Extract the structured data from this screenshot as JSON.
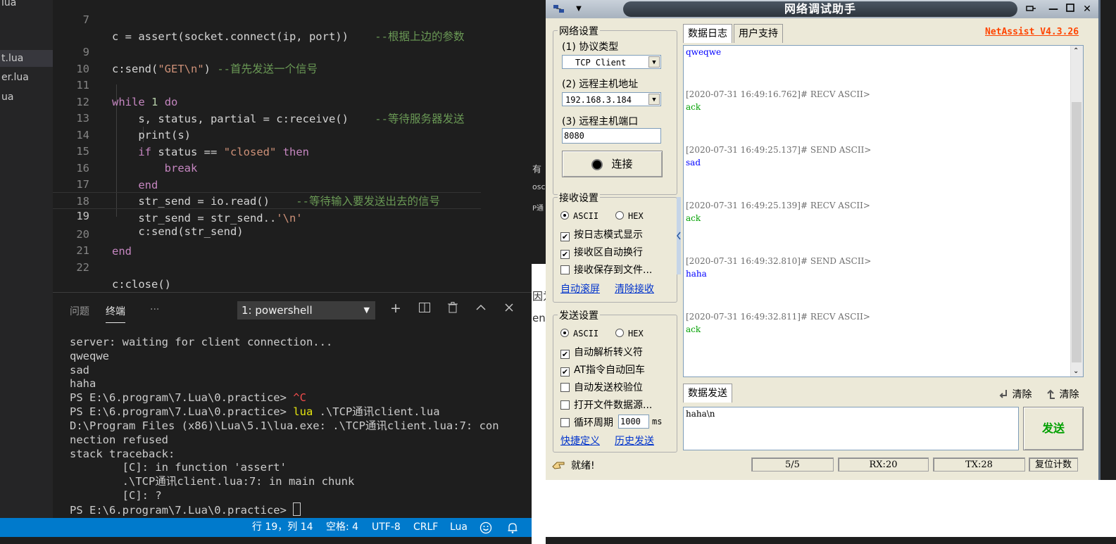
{
  "vscode": {
    "explorer": [
      "lua",
      "t.lua",
      "er.lua",
      "ua"
    ],
    "line_numbers": [
      "7",
      "9",
      "10",
      "11",
      "12",
      "13",
      "14",
      "15",
      "16",
      "17",
      "18",
      "19",
      "20",
      "21",
      "22"
    ],
    "code": {
      "l7": "c = assert(socket.connect(ip, port))",
      "l7_comment": "--根据上边的参数",
      "l9_fn": "c:send(",
      "l9_str": "\"GET\\n\"",
      "l9_close": ")",
      "l9_comment": "--首先发送一个信号",
      "l11_kw": "while",
      "l11_num": "1",
      "l11_do": "do",
      "l12": "s, status, partial = c:receive()",
      "l12_comment": "--等待服务器发送",
      "l13": "print(s)",
      "l14_if": "if",
      "l14_mid": "status ==",
      "l14_str": "\"closed\"",
      "l14_then": "then",
      "l15": "break",
      "l16": "end",
      "l17": "str_send = io.read()",
      "l17_comment": "--等待输入要发送出去的信号",
      "l18": "str_send = str_send..",
      "l18_str": "'\\n'",
      "l19": "c:send(str_send)",
      "l20": "end",
      "l22": "c:close()"
    },
    "panel": {
      "tab_problems": "问题",
      "tab_terminal": "终端",
      "more": "···",
      "terminal_select": "1: powershell"
    },
    "terminal": {
      "l1": "server: waiting for client connection...",
      "l2": "qweqwe",
      "l3": "sad",
      "l4": "haha",
      "l5_prompt": "PS E:\\6.program\\7.Lua\\0.practice> ",
      "l5_ctrl": "^C",
      "l6_prompt": "PS E:\\6.program\\7.Lua\\0.practice> ",
      "l6_cmd": "lua",
      "l6_arg": " .\\TCP通讯client.lua",
      "l7": "D:\\Program Files (x86)\\Lua\\5.1\\lua.exe: .\\TCP通讯client.lua:7: con",
      "l8": "nection refused",
      "l9": "stack traceback:",
      "l10": "        [C]: in function 'assert'",
      "l11": "        .\\TCP通讯client.lua:7: in main chunk",
      "l12": "        [C]: ?",
      "l13": "PS E:\\6.program\\7.Lua\\0.practice> "
    },
    "statusbar": {
      "position": "行 19，列 14",
      "spaces": "空格: 4",
      "encoding": "UTF-8",
      "eol": "CRLF",
      "language": "Lua"
    }
  },
  "background_page": {
    "t1": "有",
    "t2": "osc",
    "t3": "P通",
    "t4": "因为",
    "t5": "en"
  },
  "netassist": {
    "title": "网络调试助手",
    "network": {
      "group": "网络设置",
      "protocol_label": "(1) 协议类型",
      "protocol": "TCP Client",
      "host_label": "(2) 远程主机地址",
      "host": "192.168.3.184",
      "port_label": "(3) 远程主机端口",
      "port": "8080",
      "connect": "连接"
    },
    "receive": {
      "group": "接收设置",
      "ascii": "ASCII",
      "hex": "HEX",
      "opt1": "按日志模式显示",
      "opt2": "接收区自动换行",
      "opt3": "接收保存到文件...",
      "auto_scroll": "自动滚屏",
      "clear_recv": "清除接收"
    },
    "send": {
      "group": "发送设置",
      "ascii": "ASCII",
      "hex": "HEX",
      "opt1": "自动解析转义符",
      "opt2": "AT指令自动回车",
      "opt3": "自动发送校验位",
      "opt4": "打开文件数据源...",
      "opt5": "循环周期",
      "period": "1000",
      "unit": "ms",
      "shortcut": "快捷定义",
      "history": "历史发送"
    },
    "tabs": {
      "log": "数据日志",
      "support": "用户支持"
    },
    "version": "NetAssist V4.3.26",
    "log": [
      {
        "text": "qweqwe",
        "kind": "send"
      },
      {
        "text": "[2020-07-31 16:49:16.762]# RECV ASCII>",
        "kind": "ts"
      },
      {
        "text": "ack",
        "kind": "recv"
      },
      {
        "text": "[2020-07-31 16:49:25.137]# SEND ASCII>",
        "kind": "ts"
      },
      {
        "text": "sad",
        "kind": "send"
      },
      {
        "text": "[2020-07-31 16:49:25.139]# RECV ASCII>",
        "kind": "ts"
      },
      {
        "text": "ack",
        "kind": "recv"
      },
      {
        "text": "[2020-07-31 16:49:32.810]# SEND ASCII>",
        "kind": "ts"
      },
      {
        "text": "haha",
        "kind": "send"
      },
      {
        "text": "[2020-07-31 16:49:32.811]# RECV ASCII>",
        "kind": "ts"
      },
      {
        "text": "ack",
        "kind": "recv"
      }
    ],
    "send_panel": {
      "label": "数据发送",
      "clear1": "清除",
      "clear2": "清除",
      "input": "haha\\n",
      "send_button": "发送"
    },
    "status": {
      "ready": "就绪!",
      "count": "5/5",
      "rx": "RX:20",
      "tx": "TX:28",
      "reset": "复位计数"
    }
  }
}
